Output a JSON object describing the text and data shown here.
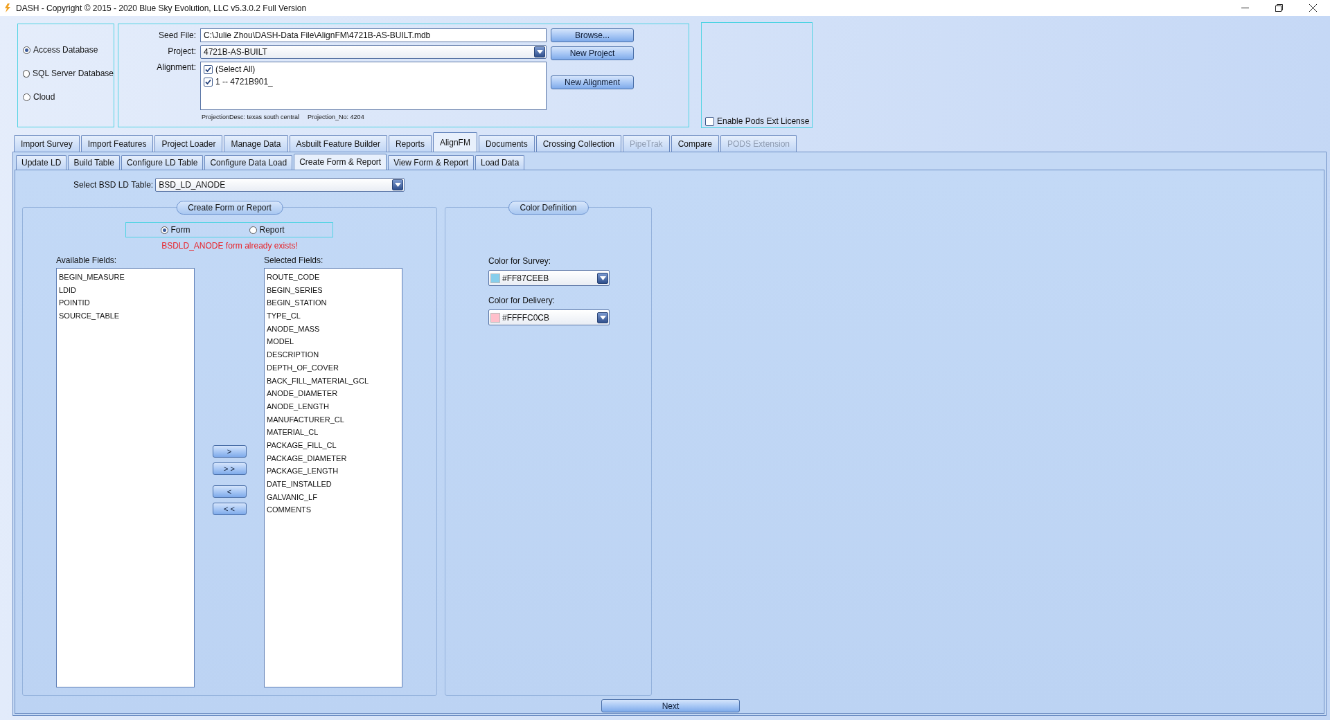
{
  "window": {
    "title": "DASH - Copyright © 2015 - 2020  Blue Sky Evolution, LLC v5.3.0.2 Full Version"
  },
  "database_options": [
    {
      "label": "Access Database",
      "selected": true
    },
    {
      "label": "SQL Server Database",
      "selected": false
    },
    {
      "label": "Cloud",
      "selected": false
    }
  ],
  "seed_file": {
    "label": "Seed File:",
    "value": "C:\\Julie Zhou\\DASH-Data File\\AlignFM\\4721B-AS-BUILT.mdb"
  },
  "project": {
    "label": "Project:",
    "value": "4721B-AS-BUILT"
  },
  "alignment": {
    "label": "Alignment:",
    "items": [
      {
        "label": "(Select All)",
        "checked": true
      },
      {
        "label": "1 -- 4721B901_",
        "checked": true
      }
    ]
  },
  "projection_desc": "ProjectionDesc: texas south central",
  "projection_no": "Projection_No: 4204",
  "top_buttons": [
    "Browse...",
    "New Project",
    "New Alignment"
  ],
  "pods_license": {
    "label": "Enable Pods Ext License",
    "checked": false
  },
  "main_tabs": [
    {
      "label": "Import Survey",
      "selected": false,
      "disabled": false
    },
    {
      "label": "Import Features",
      "selected": false,
      "disabled": false
    },
    {
      "label": "Project Loader",
      "selected": false,
      "disabled": false
    },
    {
      "label": "Manage Data",
      "selected": false,
      "disabled": false
    },
    {
      "label": "Asbuilt Feature Builder",
      "selected": false,
      "disabled": false
    },
    {
      "label": "Reports",
      "selected": false,
      "disabled": false
    },
    {
      "label": "AlignFM",
      "selected": true,
      "disabled": false
    },
    {
      "label": "Documents",
      "selected": false,
      "disabled": false
    },
    {
      "label": "Crossing Collection",
      "selected": false,
      "disabled": false
    },
    {
      "label": "PipeTrak",
      "selected": false,
      "disabled": true
    },
    {
      "label": "Compare",
      "selected": false,
      "disabled": false
    },
    {
      "label": "PODS Extension",
      "selected": false,
      "disabled": true
    }
  ],
  "sub_tabs": [
    {
      "label": "Update LD",
      "selected": false
    },
    {
      "label": "Build Table",
      "selected": false
    },
    {
      "label": "Configure LD Table",
      "selected": false
    },
    {
      "label": "Configure Data Load",
      "selected": false
    },
    {
      "label": "Create Form & Report",
      "selected": true
    },
    {
      "label": "View Form & Report",
      "selected": false
    },
    {
      "label": "Load Data",
      "selected": false
    }
  ],
  "bsd_table": {
    "label": "Select BSD LD Table:",
    "value": "BSD_LD_ANODE"
  },
  "form_group": {
    "title": "Create Form or Report",
    "modes": [
      {
        "label": "Form",
        "selected": true
      },
      {
        "label": "Report",
        "selected": false
      }
    ],
    "message": "BSDLD_ANODE form already exists!",
    "available_label": "Available Fields:",
    "available_fields": [
      "BEGIN_MEASURE",
      "LDID",
      "POINTID",
      "SOURCE_TABLE"
    ],
    "selected_label": "Selected Fields:",
    "selected_fields": [
      "ROUTE_CODE",
      "BEGIN_SERIES",
      "BEGIN_STATION",
      "TYPE_CL",
      "ANODE_MASS",
      "MODEL",
      "DESCRIPTION",
      "DEPTH_OF_COVER",
      "BACK_FILL_MATERIAL_GCL",
      "ANODE_DIAMETER",
      "ANODE_LENGTH",
      "MANUFACTURER_CL",
      "MATERIAL_CL",
      "PACKAGE_FILL_CL",
      "PACKAGE_DIAMETER",
      "PACKAGE_LENGTH",
      "DATE_INSTALLED",
      "GALVANIC_LF",
      "COMMENTS"
    ],
    "move_buttons": [
      ">",
      "> >",
      "<",
      "< <"
    ]
  },
  "color_group": {
    "title": "Color Definition",
    "pickers": [
      {
        "label": "Color for Survey:",
        "value": "#FF87CEEB",
        "color": "#87ceeb"
      },
      {
        "label": "Color for Delivery:",
        "value": "#FFFFC0CB",
        "color": "#ffc0cb"
      }
    ]
  },
  "next_button": "Next"
}
